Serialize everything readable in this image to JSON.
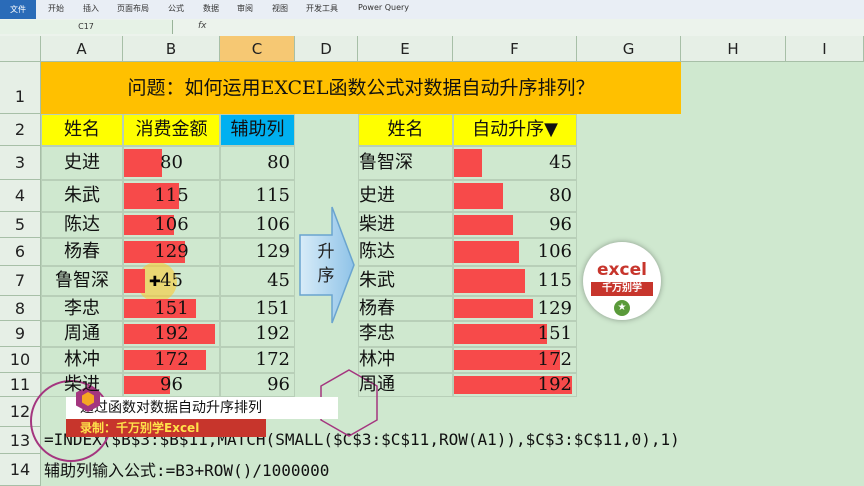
{
  "ribbon": {
    "file": "文件",
    "tabs": [
      "开始",
      "插入",
      "页面布局",
      "公式",
      "数据",
      "审阅",
      "视图",
      "开发工具",
      "Power Query"
    ]
  },
  "formula_bar": {
    "name_box": "C17",
    "fx": "fx",
    "content": ""
  },
  "columns": [
    "A",
    "B",
    "C",
    "D",
    "E",
    "F",
    "G",
    "H",
    "I"
  ],
  "rows": [
    "1",
    "2",
    "3",
    "4",
    "5",
    "6",
    "7",
    "8",
    "9",
    "10",
    "11",
    "12",
    "13",
    "14"
  ],
  "title": "问题：如何运用EXCEL函数公式对数据自动升序排列？",
  "left_table": {
    "headers": [
      "姓名",
      "消费金额",
      "辅助列"
    ],
    "rows": [
      {
        "name": "史进",
        "amount": 80,
        "helper": 80
      },
      {
        "name": "朱武",
        "amount": 115,
        "helper": 115
      },
      {
        "name": "陈达",
        "amount": 106,
        "helper": 106
      },
      {
        "name": "杨春",
        "amount": 129,
        "helper": 129
      },
      {
        "name": "鲁智深",
        "amount": 45,
        "helper": 45
      },
      {
        "name": "李忠",
        "amount": 151,
        "helper": 151
      },
      {
        "name": "周通",
        "amount": 192,
        "helper": 192
      },
      {
        "name": "林冲",
        "amount": 172,
        "helper": 172
      },
      {
        "name": "柴进",
        "amount": 96,
        "helper": 96
      }
    ]
  },
  "right_table": {
    "headers": [
      "姓名",
      "自动升序▼"
    ],
    "rows": [
      {
        "name": "鲁智深",
        "value": 45
      },
      {
        "name": "史进",
        "value": 80
      },
      {
        "name": "柴进",
        "value": 96
      },
      {
        "name": "陈达",
        "value": 106
      },
      {
        "name": "朱武",
        "value": 115
      },
      {
        "name": "杨春",
        "value": 129
      },
      {
        "name": "李忠",
        "value": 151
      },
      {
        "name": "林冲",
        "value": 172
      },
      {
        "name": "周通",
        "value": 192
      }
    ]
  },
  "bar_max": 192,
  "arrow_label": "升序",
  "formula_13": "=INDEX($B$3:$B$11,MATCH(SMALL($C$3:$C$11,ROW(A1)),$C$3:$C$11,0),1)",
  "formula_14": "辅助列输入公式:=B3+ROW()/1000000",
  "banner": {
    "line1": "通过函数对数据自动升序排列",
    "line2": "录制：千万别学Excel"
  },
  "logo": {
    "line1": "excel",
    "line2": "千万别学",
    "icon": "star-icon"
  },
  "colors": {
    "bar": "#f74a4a",
    "title_bg": "#ffc000",
    "header_yellow": "#ffff00",
    "header_blue": "#00b0f0",
    "sheet_bg": "#cfe8cf"
  }
}
